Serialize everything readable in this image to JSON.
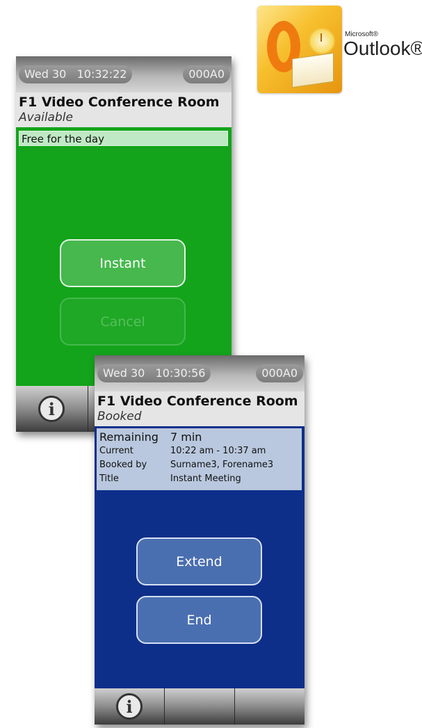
{
  "logo": {
    "brand_small": "Microsoft®",
    "brand_name": "Outlook®"
  },
  "screens": [
    {
      "status": {
        "date": "Wed 30",
        "time": "10:32:22",
        "code": "000A0"
      },
      "room": {
        "name": "F1 Video Conference Room",
        "state": "Available"
      },
      "notice": "Free for the day",
      "buttons": {
        "primary": "Instant",
        "secondary": "Cancel"
      },
      "footer_icon": "info-icon",
      "colors": {
        "content_bg": "#13a41b"
      }
    },
    {
      "status": {
        "date": "Wed 30",
        "time": "10:30:56",
        "code": "000A0"
      },
      "room": {
        "name": "F1 Video Conference Room",
        "state": "Booked"
      },
      "booking": {
        "remaining_label": "Remaining",
        "remaining_value": "7 min",
        "current_label": "Current",
        "current_value": "10:22 am - 10:37 am",
        "booked_by_label": "Booked by",
        "booked_by_value": "Surname3, Forename3",
        "title_label": "Title",
        "title_value": "Instant Meeting"
      },
      "buttons": {
        "primary": "Extend",
        "secondary": "End"
      },
      "footer_icon": "info-icon",
      "colors": {
        "content_bg": "#0d2f8a"
      }
    }
  ]
}
